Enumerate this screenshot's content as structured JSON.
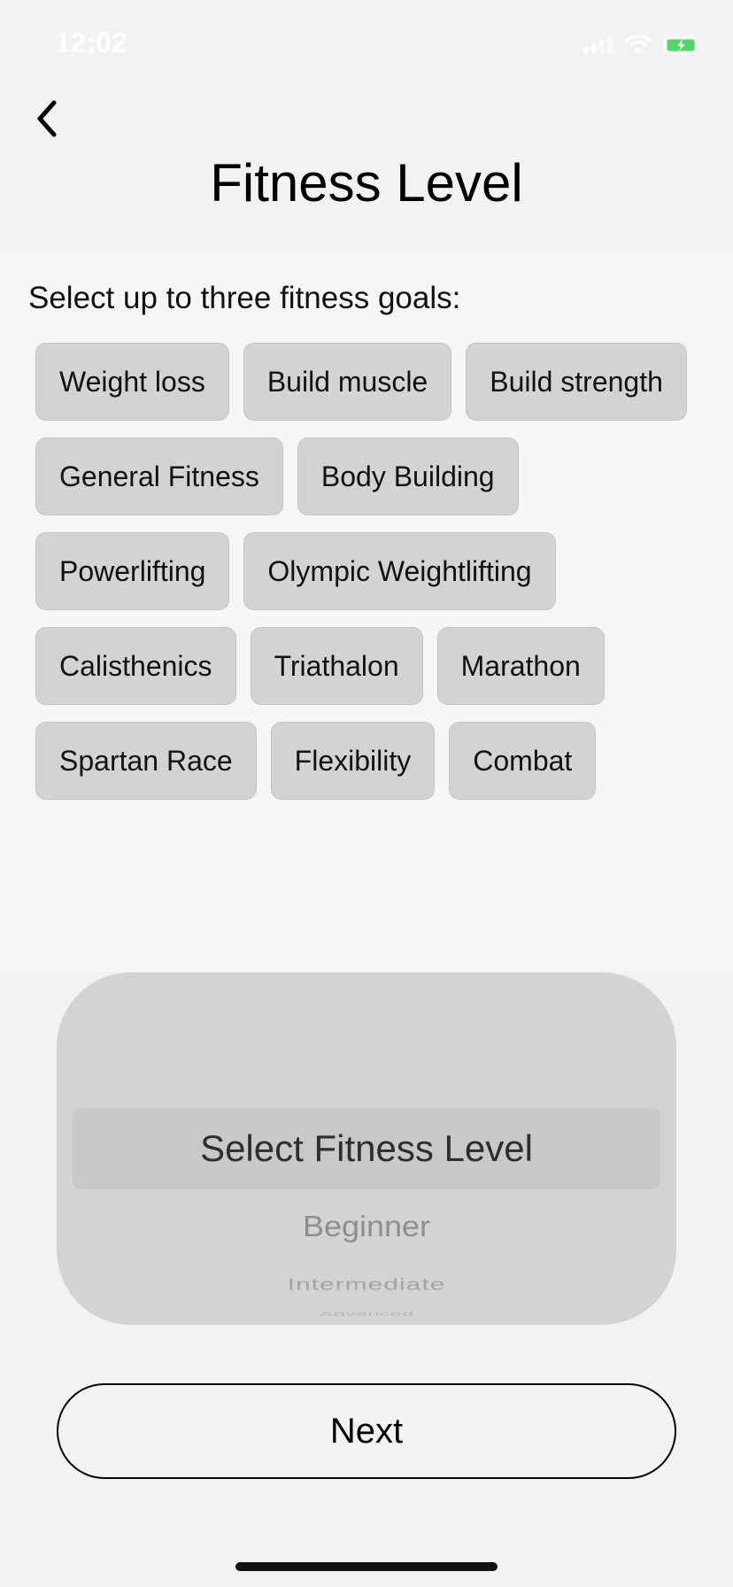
{
  "status_bar": {
    "time": "12:02",
    "icons": [
      "cellular-signal-icon",
      "wifi-icon",
      "battery-charging-icon"
    ],
    "battery_color": "#4cd964"
  },
  "header": {
    "back_icon": "chevron-left-icon",
    "title": "Fitness Level"
  },
  "goals": {
    "prompt": "Select up to three fitness goals:",
    "rows": [
      [
        "Weight loss",
        "Build muscle",
        "Build strength"
      ],
      [
        "General Fitness",
        "Body Building"
      ],
      [
        "Powerlifting",
        "Olympic Weightlifting"
      ],
      [
        "Calisthenics",
        "Triathalon",
        "Marathon"
      ],
      [
        "Spartan Race",
        "Flexibility",
        "Combat"
      ]
    ]
  },
  "picker": {
    "selected": "Select Fitness Level",
    "options": [
      "Beginner",
      "Intermediate",
      "Advanced"
    ]
  },
  "footer": {
    "next_label": "Next"
  }
}
